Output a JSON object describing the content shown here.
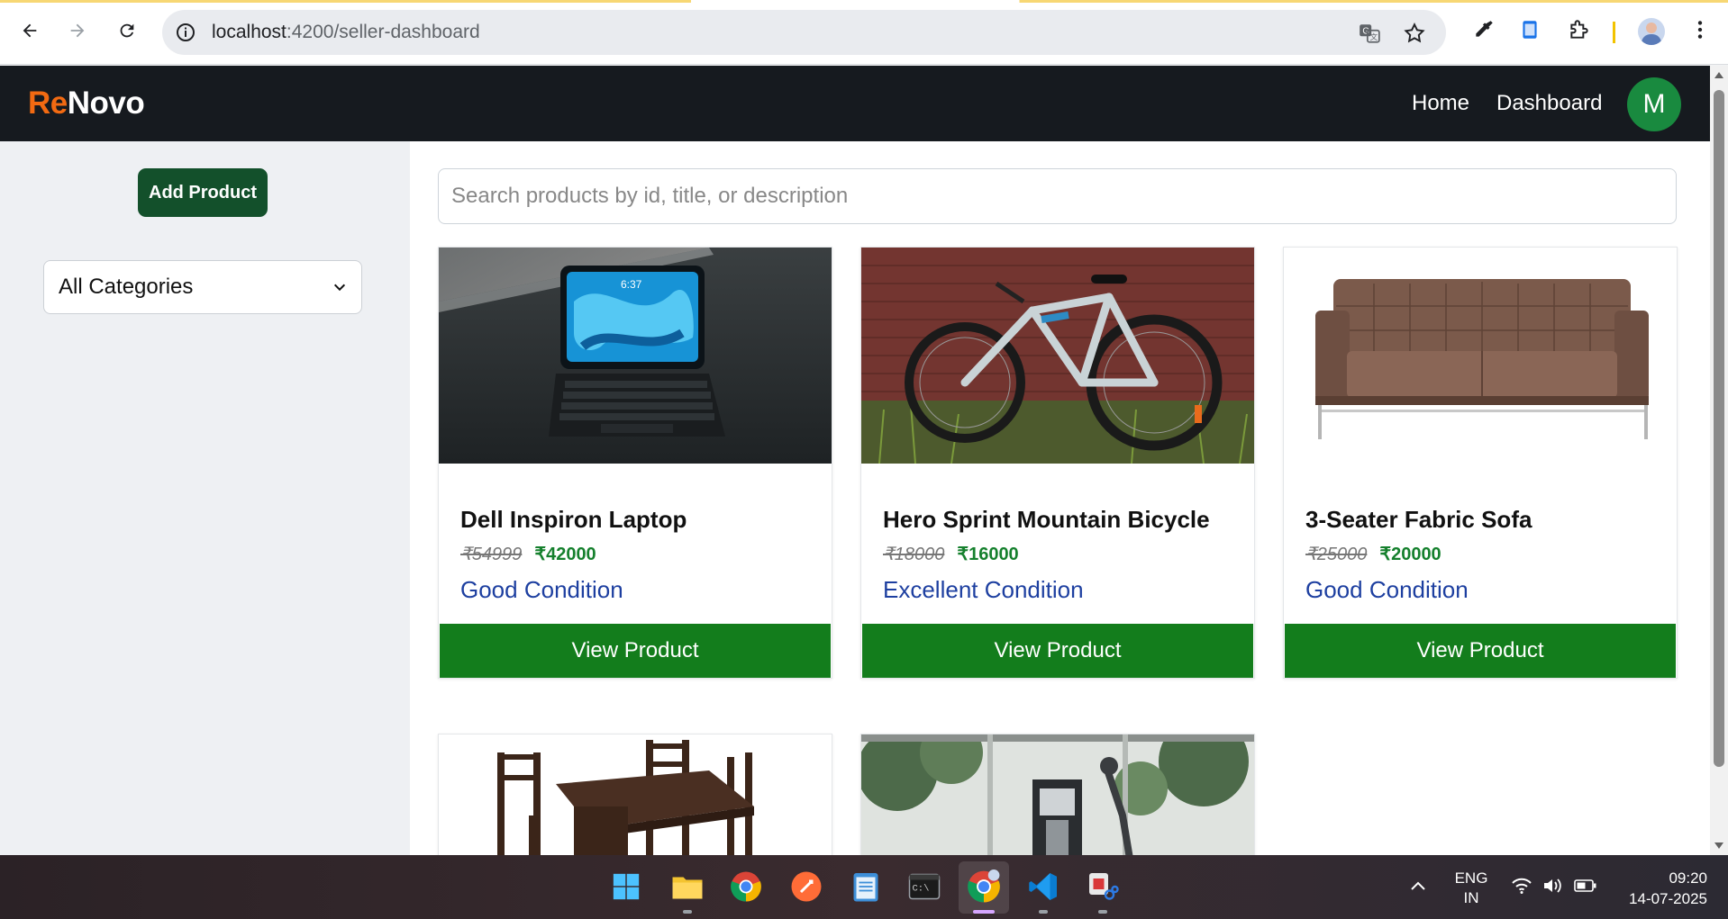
{
  "browser": {
    "url_host": "localhost",
    "url_path": ":4200/seller-dashboard"
  },
  "header": {
    "logo_part1": "Re",
    "logo_part2": "Novo",
    "nav": [
      "Home",
      "Dashboard"
    ],
    "avatar_initial": "M"
  },
  "sidebar": {
    "add_button": "Add Product",
    "category_selected": "All Categories"
  },
  "search": {
    "placeholder": "Search products by id, title, or description"
  },
  "products": [
    {
      "title": "Dell Inspiron Laptop",
      "old_price": "₹54999",
      "new_price": "₹42000",
      "condition": "Good Condition",
      "button": "View Product",
      "image": "laptop"
    },
    {
      "title": "Hero Sprint Mountain Bicycle",
      "old_price": "₹18000",
      "new_price": "₹16000",
      "condition": "Excellent Condition",
      "button": "View Product",
      "image": "bicycle"
    },
    {
      "title": "3-Seater Fabric Sofa",
      "old_price": "₹25000",
      "new_price": "₹20000",
      "condition": "Good Condition",
      "button": "View Product",
      "image": "sofa"
    },
    {
      "image": "dining-table"
    },
    {
      "image": "treadmill"
    }
  ],
  "taskbar": {
    "lang_line1": "ENG",
    "lang_line2": "IN",
    "time": "09:20",
    "date": "14-07-2025"
  },
  "colors": {
    "brand_orange": "#f26a12",
    "header_bg": "#161a1f",
    "button_green": "#137d1c",
    "price_green": "#15802d",
    "condition_blue": "#1d3fa0"
  }
}
